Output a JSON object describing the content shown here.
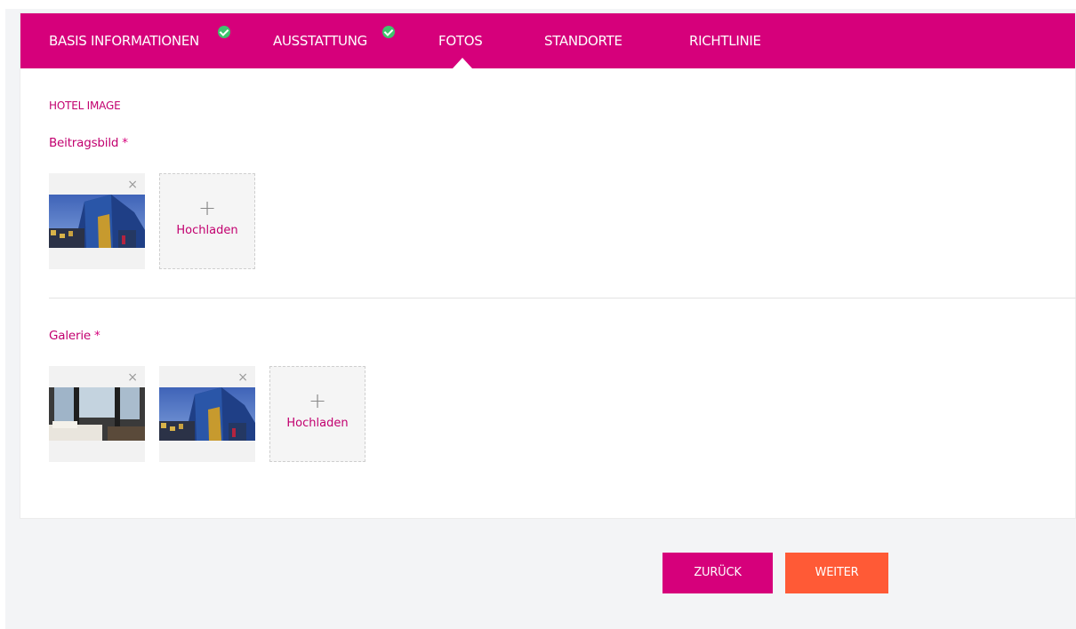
{
  "tabs": [
    {
      "label": "BASIS INFORMATIONEN",
      "completed": true
    },
    {
      "label": "AUSSTATTUNG",
      "completed": true
    },
    {
      "label": "FOTOS",
      "active": true
    },
    {
      "label": "STANDORTE"
    },
    {
      "label": "RICHTLINIE"
    }
  ],
  "section_title": "HOTEL IMAGE",
  "featured": {
    "label": "Beitragsbild",
    "required_mark": "*",
    "upload_label": "Hochladen",
    "remove_icon": "×"
  },
  "gallery": {
    "label": "Galerie",
    "required_mark": "*",
    "upload_label": "Hochladen",
    "remove_icon": "×"
  },
  "buttons": {
    "back": "ZURÜCK",
    "next": "WEITER"
  },
  "colors": {
    "brand": "#d6007b",
    "next_button": "#ff5a36",
    "check": "#3ec46d"
  },
  "icons": {
    "plus": "+",
    "check": "check-circle-icon"
  }
}
